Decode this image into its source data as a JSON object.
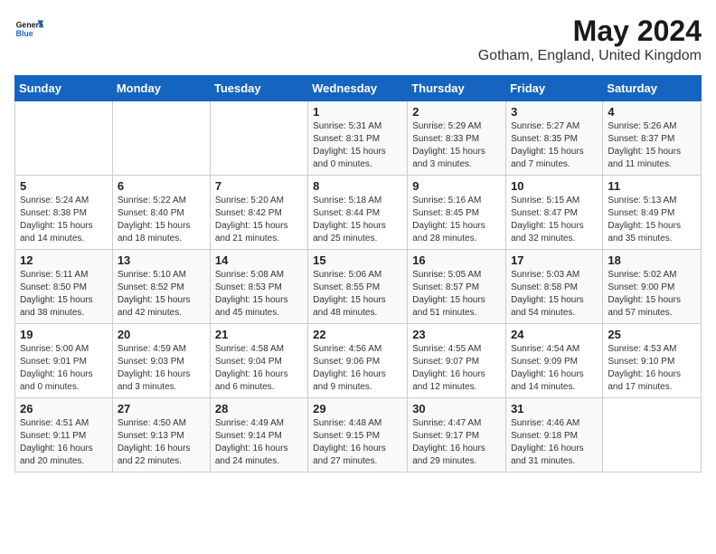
{
  "header": {
    "logo_general": "General",
    "logo_blue": "Blue",
    "title": "May 2024",
    "subtitle": "Gotham, England, United Kingdom"
  },
  "days_of_week": [
    "Sunday",
    "Monday",
    "Tuesday",
    "Wednesday",
    "Thursday",
    "Friday",
    "Saturday"
  ],
  "weeks": [
    [
      {
        "day": "",
        "sunrise": "",
        "sunset": "",
        "daylight": ""
      },
      {
        "day": "",
        "sunrise": "",
        "sunset": "",
        "daylight": ""
      },
      {
        "day": "",
        "sunrise": "",
        "sunset": "",
        "daylight": ""
      },
      {
        "day": "1",
        "sunrise": "Sunrise: 5:31 AM",
        "sunset": "Sunset: 8:31 PM",
        "daylight": "Daylight: 15 hours and 0 minutes."
      },
      {
        "day": "2",
        "sunrise": "Sunrise: 5:29 AM",
        "sunset": "Sunset: 8:33 PM",
        "daylight": "Daylight: 15 hours and 3 minutes."
      },
      {
        "day": "3",
        "sunrise": "Sunrise: 5:27 AM",
        "sunset": "Sunset: 8:35 PM",
        "daylight": "Daylight: 15 hours and 7 minutes."
      },
      {
        "day": "4",
        "sunrise": "Sunrise: 5:26 AM",
        "sunset": "Sunset: 8:37 PM",
        "daylight": "Daylight: 15 hours and 11 minutes."
      }
    ],
    [
      {
        "day": "5",
        "sunrise": "Sunrise: 5:24 AM",
        "sunset": "Sunset: 8:38 PM",
        "daylight": "Daylight: 15 hours and 14 minutes."
      },
      {
        "day": "6",
        "sunrise": "Sunrise: 5:22 AM",
        "sunset": "Sunset: 8:40 PM",
        "daylight": "Daylight: 15 hours and 18 minutes."
      },
      {
        "day": "7",
        "sunrise": "Sunrise: 5:20 AM",
        "sunset": "Sunset: 8:42 PM",
        "daylight": "Daylight: 15 hours and 21 minutes."
      },
      {
        "day": "8",
        "sunrise": "Sunrise: 5:18 AM",
        "sunset": "Sunset: 8:44 PM",
        "daylight": "Daylight: 15 hours and 25 minutes."
      },
      {
        "day": "9",
        "sunrise": "Sunrise: 5:16 AM",
        "sunset": "Sunset: 8:45 PM",
        "daylight": "Daylight: 15 hours and 28 minutes."
      },
      {
        "day": "10",
        "sunrise": "Sunrise: 5:15 AM",
        "sunset": "Sunset: 8:47 PM",
        "daylight": "Daylight: 15 hours and 32 minutes."
      },
      {
        "day": "11",
        "sunrise": "Sunrise: 5:13 AM",
        "sunset": "Sunset: 8:49 PM",
        "daylight": "Daylight: 15 hours and 35 minutes."
      }
    ],
    [
      {
        "day": "12",
        "sunrise": "Sunrise: 5:11 AM",
        "sunset": "Sunset: 8:50 PM",
        "daylight": "Daylight: 15 hours and 38 minutes."
      },
      {
        "day": "13",
        "sunrise": "Sunrise: 5:10 AM",
        "sunset": "Sunset: 8:52 PM",
        "daylight": "Daylight: 15 hours and 42 minutes."
      },
      {
        "day": "14",
        "sunrise": "Sunrise: 5:08 AM",
        "sunset": "Sunset: 8:53 PM",
        "daylight": "Daylight: 15 hours and 45 minutes."
      },
      {
        "day": "15",
        "sunrise": "Sunrise: 5:06 AM",
        "sunset": "Sunset: 8:55 PM",
        "daylight": "Daylight: 15 hours and 48 minutes."
      },
      {
        "day": "16",
        "sunrise": "Sunrise: 5:05 AM",
        "sunset": "Sunset: 8:57 PM",
        "daylight": "Daylight: 15 hours and 51 minutes."
      },
      {
        "day": "17",
        "sunrise": "Sunrise: 5:03 AM",
        "sunset": "Sunset: 8:58 PM",
        "daylight": "Daylight: 15 hours and 54 minutes."
      },
      {
        "day": "18",
        "sunrise": "Sunrise: 5:02 AM",
        "sunset": "Sunset: 9:00 PM",
        "daylight": "Daylight: 15 hours and 57 minutes."
      }
    ],
    [
      {
        "day": "19",
        "sunrise": "Sunrise: 5:00 AM",
        "sunset": "Sunset: 9:01 PM",
        "daylight": "Daylight: 16 hours and 0 minutes."
      },
      {
        "day": "20",
        "sunrise": "Sunrise: 4:59 AM",
        "sunset": "Sunset: 9:03 PM",
        "daylight": "Daylight: 16 hours and 3 minutes."
      },
      {
        "day": "21",
        "sunrise": "Sunrise: 4:58 AM",
        "sunset": "Sunset: 9:04 PM",
        "daylight": "Daylight: 16 hours and 6 minutes."
      },
      {
        "day": "22",
        "sunrise": "Sunrise: 4:56 AM",
        "sunset": "Sunset: 9:06 PM",
        "daylight": "Daylight: 16 hours and 9 minutes."
      },
      {
        "day": "23",
        "sunrise": "Sunrise: 4:55 AM",
        "sunset": "Sunset: 9:07 PM",
        "daylight": "Daylight: 16 hours and 12 minutes."
      },
      {
        "day": "24",
        "sunrise": "Sunrise: 4:54 AM",
        "sunset": "Sunset: 9:09 PM",
        "daylight": "Daylight: 16 hours and 14 minutes."
      },
      {
        "day": "25",
        "sunrise": "Sunrise: 4:53 AM",
        "sunset": "Sunset: 9:10 PM",
        "daylight": "Daylight: 16 hours and 17 minutes."
      }
    ],
    [
      {
        "day": "26",
        "sunrise": "Sunrise: 4:51 AM",
        "sunset": "Sunset: 9:11 PM",
        "daylight": "Daylight: 16 hours and 20 minutes."
      },
      {
        "day": "27",
        "sunrise": "Sunrise: 4:50 AM",
        "sunset": "Sunset: 9:13 PM",
        "daylight": "Daylight: 16 hours and 22 minutes."
      },
      {
        "day": "28",
        "sunrise": "Sunrise: 4:49 AM",
        "sunset": "Sunset: 9:14 PM",
        "daylight": "Daylight: 16 hours and 24 minutes."
      },
      {
        "day": "29",
        "sunrise": "Sunrise: 4:48 AM",
        "sunset": "Sunset: 9:15 PM",
        "daylight": "Daylight: 16 hours and 27 minutes."
      },
      {
        "day": "30",
        "sunrise": "Sunrise: 4:47 AM",
        "sunset": "Sunset: 9:17 PM",
        "daylight": "Daylight: 16 hours and 29 minutes."
      },
      {
        "day": "31",
        "sunrise": "Sunrise: 4:46 AM",
        "sunset": "Sunset: 9:18 PM",
        "daylight": "Daylight: 16 hours and 31 minutes."
      },
      {
        "day": "",
        "sunrise": "",
        "sunset": "",
        "daylight": ""
      }
    ]
  ]
}
